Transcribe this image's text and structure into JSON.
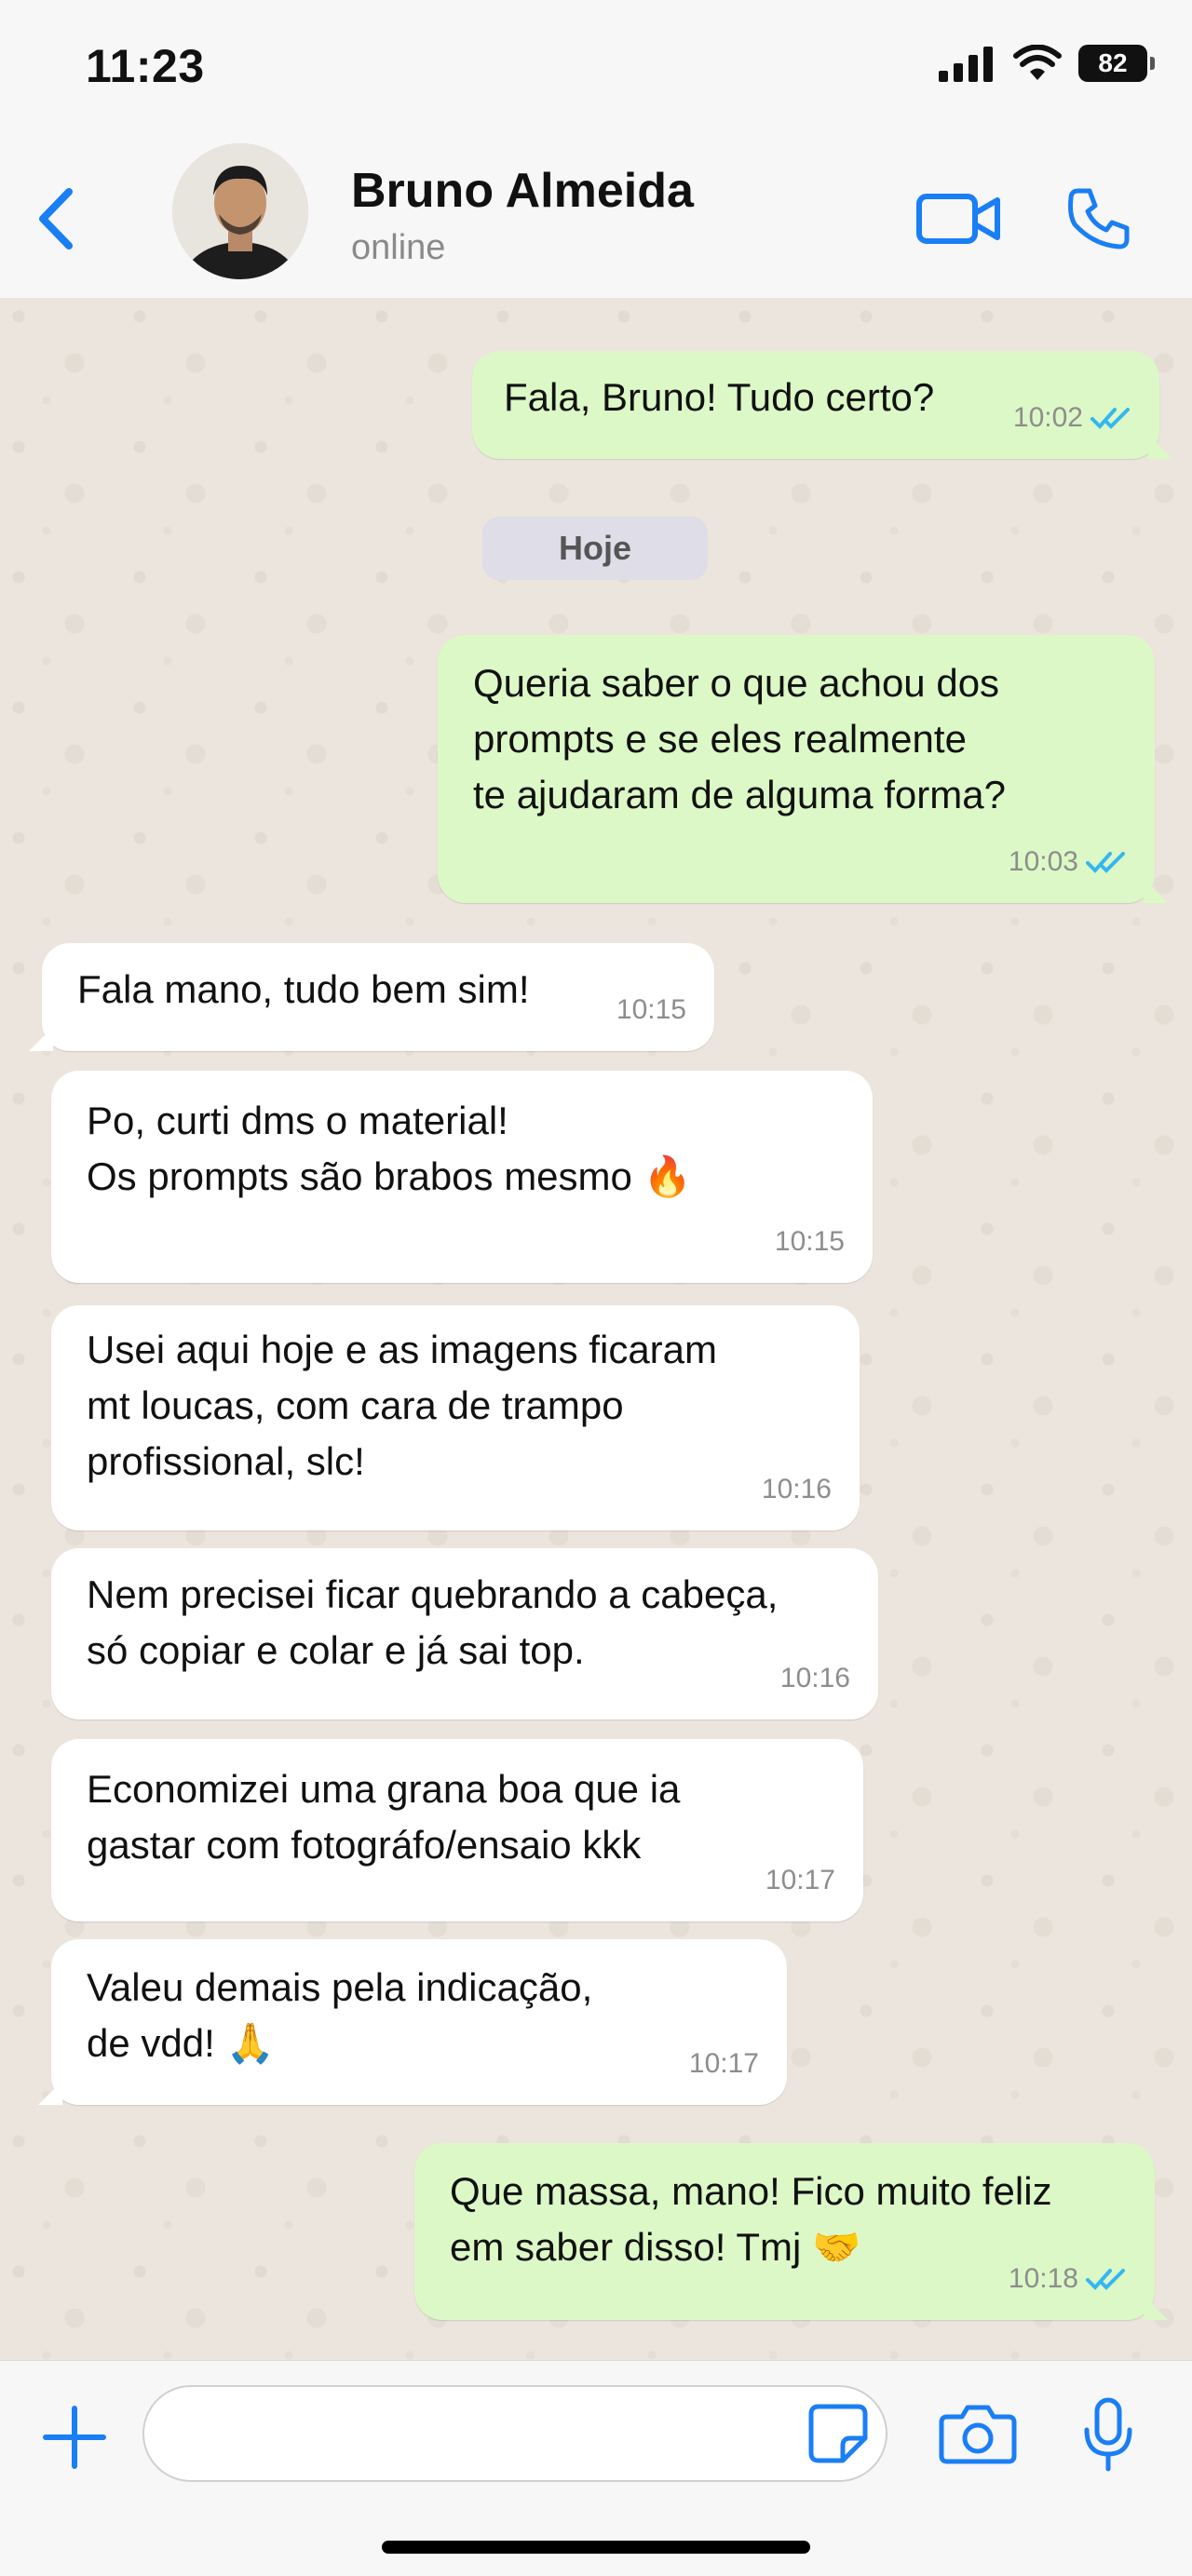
{
  "status_bar": {
    "time": "11:23",
    "battery": "82"
  },
  "header": {
    "contact_name": "Bruno Almeida",
    "contact_status": "online"
  },
  "colors": {
    "accent": "#1a7ef5",
    "outgoing_bubble": "#dcf8c6",
    "incoming_bubble": "#ffffff",
    "read_ticks": "#34b7f1",
    "chat_background": "#ece5dd"
  },
  "date_separator": "Hoje",
  "messages": [
    {
      "direction": "out",
      "text": "Fala, Bruno! Tudo certo?",
      "time": "10:02",
      "read": true
    },
    {
      "direction": "out",
      "text": "Queria saber o que achou dos\nprompts e se eles realmente\nte ajudaram de alguma forma?",
      "time": "10:03",
      "read": true
    },
    {
      "direction": "in",
      "text": "Fala mano, tudo bem sim!",
      "time": "10:15"
    },
    {
      "direction": "in",
      "text": "Po, curti dms o material!\nOs prompts são brabos mesmo 🔥",
      "time": "10:15"
    },
    {
      "direction": "in",
      "text": "Usei aqui hoje e as imagens ficaram\nmt loucas, com cara de trampo\nprofissional, slc!",
      "time": "10:16"
    },
    {
      "direction": "in",
      "text": "Nem precisei ficar quebrando a cabeça,\nsó copiar e colar e já sai top.",
      "time": "10:16"
    },
    {
      "direction": "in",
      "text": "Economizei uma grana boa que ia\ngastar com fotográfo/ensaio kkk",
      "time": "10:17"
    },
    {
      "direction": "in",
      "text": "Valeu demais pela indicação,\nde vdd! 🙏",
      "time": "10:17"
    },
    {
      "direction": "out",
      "text": "Que massa, mano! Fico muito feliz\nem saber disso! Tmj 🤝",
      "time": "10:18",
      "read": true
    }
  ],
  "input": {
    "value": "",
    "placeholder": ""
  },
  "icons": {
    "back": "chevron-left-icon",
    "video": "video-camera-icon",
    "call": "phone-icon",
    "attach": "plus-icon",
    "sticker": "sticker-icon",
    "camera": "camera-icon",
    "mic": "microphone-icon",
    "signal": "cellular-signal-icon",
    "wifi": "wifi-icon",
    "battery": "battery-icon",
    "read": "double-check-icon"
  }
}
